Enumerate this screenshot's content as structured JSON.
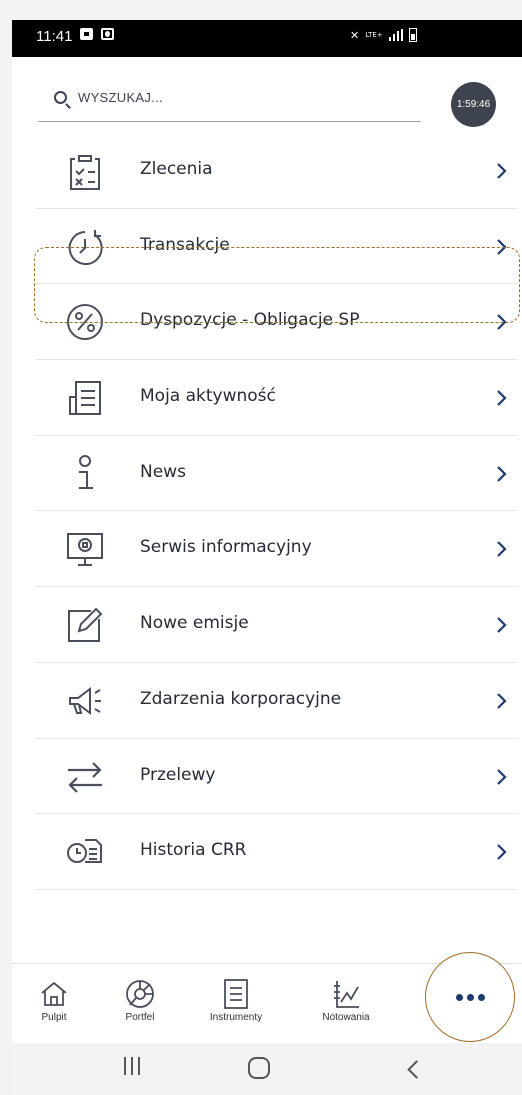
{
  "status_bar": {
    "time": "11:41",
    "network": "LTE+"
  },
  "search": {
    "placeholder": "WYSZUKAJ...",
    "timer": "1:59:46"
  },
  "menu": {
    "items": [
      {
        "label": "Zlecenia",
        "icon": "checklist-icon"
      },
      {
        "label": "Transakcje",
        "icon": "history-clock-icon"
      },
      {
        "label": "Dyspozycje - Obligacje SP",
        "icon": "percent-icon",
        "highlighted": true
      },
      {
        "label": "Moja aktywność",
        "icon": "document-list-icon"
      },
      {
        "label": "News",
        "icon": "info-icon"
      },
      {
        "label": "Serwis informacyjny",
        "icon": "monitor-search-icon"
      },
      {
        "label": "Nowe emisje",
        "icon": "edit-icon"
      },
      {
        "label": "Zdarzenia korporacyjne",
        "icon": "megaphone-icon"
      },
      {
        "label": "Przelewy",
        "icon": "transfer-arrows-icon"
      },
      {
        "label": "Historia CRR",
        "icon": "clock-document-icon"
      }
    ]
  },
  "bottom_nav": {
    "items": [
      {
        "label": "Pulpit",
        "icon": "home-icon"
      },
      {
        "label": "Portfel",
        "icon": "pie-chart-icon"
      },
      {
        "label": "Instrumenty",
        "icon": "list-icon"
      },
      {
        "label": "Notowania",
        "icon": "line-chart-icon"
      }
    ],
    "more_icon": "more-dots-icon"
  },
  "colors": {
    "accent": "#1e3a6d",
    "highlight": "#a06e2a",
    "icon": "#4a4f5c"
  }
}
